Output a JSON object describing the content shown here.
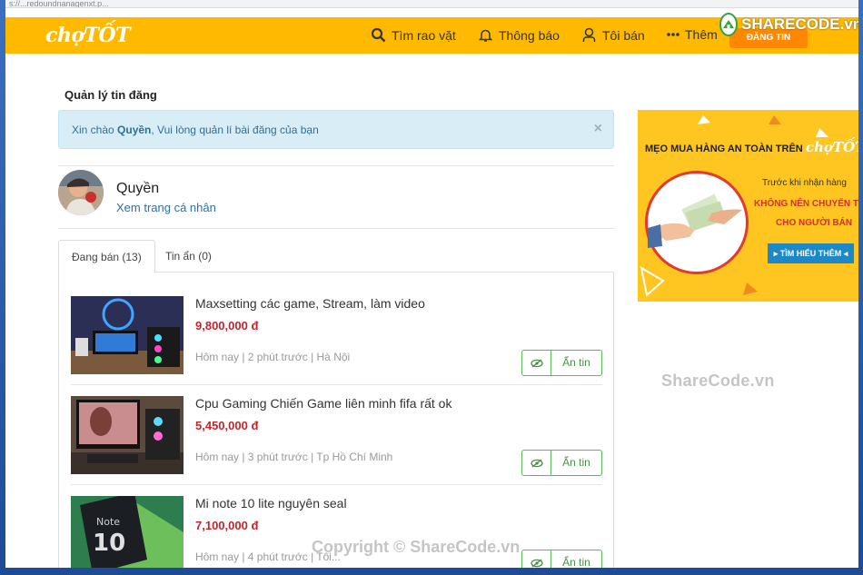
{
  "browser": {
    "url": "s://...redoundnanagenxt.p..."
  },
  "header": {
    "logo": "chợTỐT",
    "nav": [
      {
        "label": "Tìm rao vặt",
        "icon": "search-icon"
      },
      {
        "label": "Thông báo",
        "icon": "bell-icon"
      },
      {
        "label": "Tôi bán",
        "icon": "user-icon"
      },
      {
        "label": "Thêm",
        "icon": "more-dots-icon"
      }
    ],
    "post_button": "ĐĂNG TIN",
    "badge": "SHARECODE.vn"
  },
  "page": {
    "title": "Quản lý tin đăng",
    "alert": {
      "prefix": "Xin chào ",
      "name": "Quyền",
      "suffix": ", Vui lòng quản lí bài đăng của bạn",
      "close": "×"
    },
    "user": {
      "name": "Quyền",
      "profile_link": "Xem trang cá nhân"
    },
    "tabs": [
      {
        "label": "Đang bán (13)"
      },
      {
        "label": "Tin ẩn (0)"
      }
    ],
    "items": [
      {
        "title": "Maxsetting các game, Stream, làm video",
        "price": "9,800,000 đ",
        "meta": "Hôm nay | 2 phút trước | Hà Nội",
        "action": "Ẩn tin"
      },
      {
        "title": "Cpu Gaming Chiến Game liên minh fifa rất ok",
        "price": "5,450,000 đ",
        "meta": "Hôm nay | 3 phút trước | Tp Hồ Chí Minh",
        "action": "Ẩn tin"
      },
      {
        "title": "Mi note 10 lite nguyên seal",
        "price": "7,100,000 đ",
        "meta": "Hôm nay | 4 phút trước | Tôi...",
        "action": "Ẩn tin"
      }
    ]
  },
  "ad": {
    "headline": "MẸO MUA HÀNG AN TOÀN TRÊN",
    "brand": "chợTỐT",
    "line1": "Trước khi nhận hàng",
    "line2": "KHÔNG NÊN CHUYỂN TIỀN",
    "line3": "CHO NGƯỜI BÁN",
    "button": "TÌM HIỂU THÊM"
  },
  "watermark": "ShareCode.vn",
  "copyright": "Copyright © ShareCode.vn",
  "colors": {
    "header": "#ffba00",
    "post_button": "#ff8800",
    "price": "#c0272d",
    "link": "#2f6ea5",
    "action_green": "#5cb85c"
  }
}
